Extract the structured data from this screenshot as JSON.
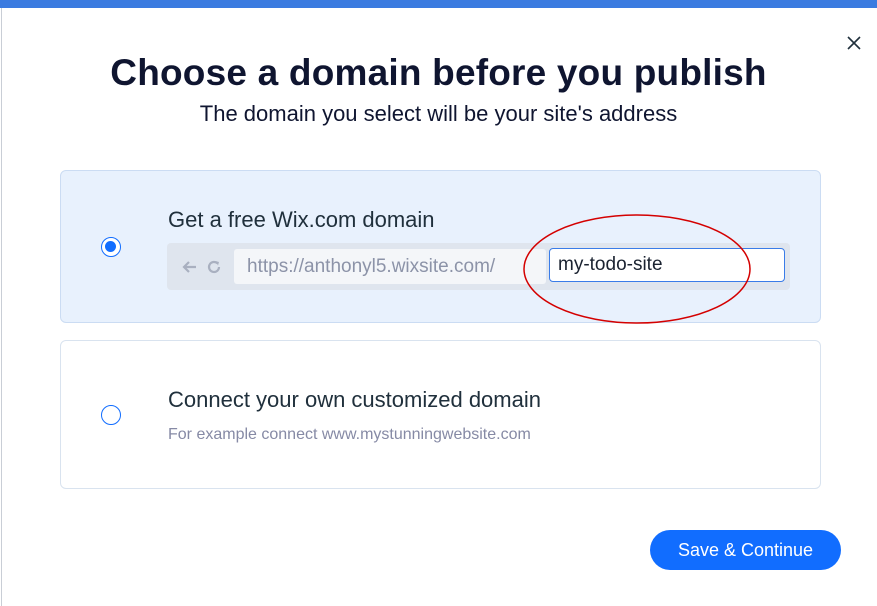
{
  "dialog": {
    "title": "Choose a domain before you publish",
    "subtitle": "The domain you select will be your site's address",
    "close_icon": "close-icon"
  },
  "options": {
    "free": {
      "label": "Get a free Wix.com domain",
      "selected": true,
      "url_prefix": "https://anthonyl5.wixsite.com/",
      "site_name_value": "my-todo-site",
      "back_icon": "arrow-left-icon",
      "reload_icon": "reload-icon"
    },
    "custom": {
      "label": "Connect your own customized domain",
      "hint": "For example connect www.mystunningwebsite.com",
      "selected": false
    }
  },
  "footer": {
    "save_label": "Save & Continue"
  },
  "colors": {
    "accent": "#116dff",
    "selected_card_bg": "#e8f1fd",
    "annotation_circle": "#d40000",
    "title_text": "#0f1530"
  }
}
